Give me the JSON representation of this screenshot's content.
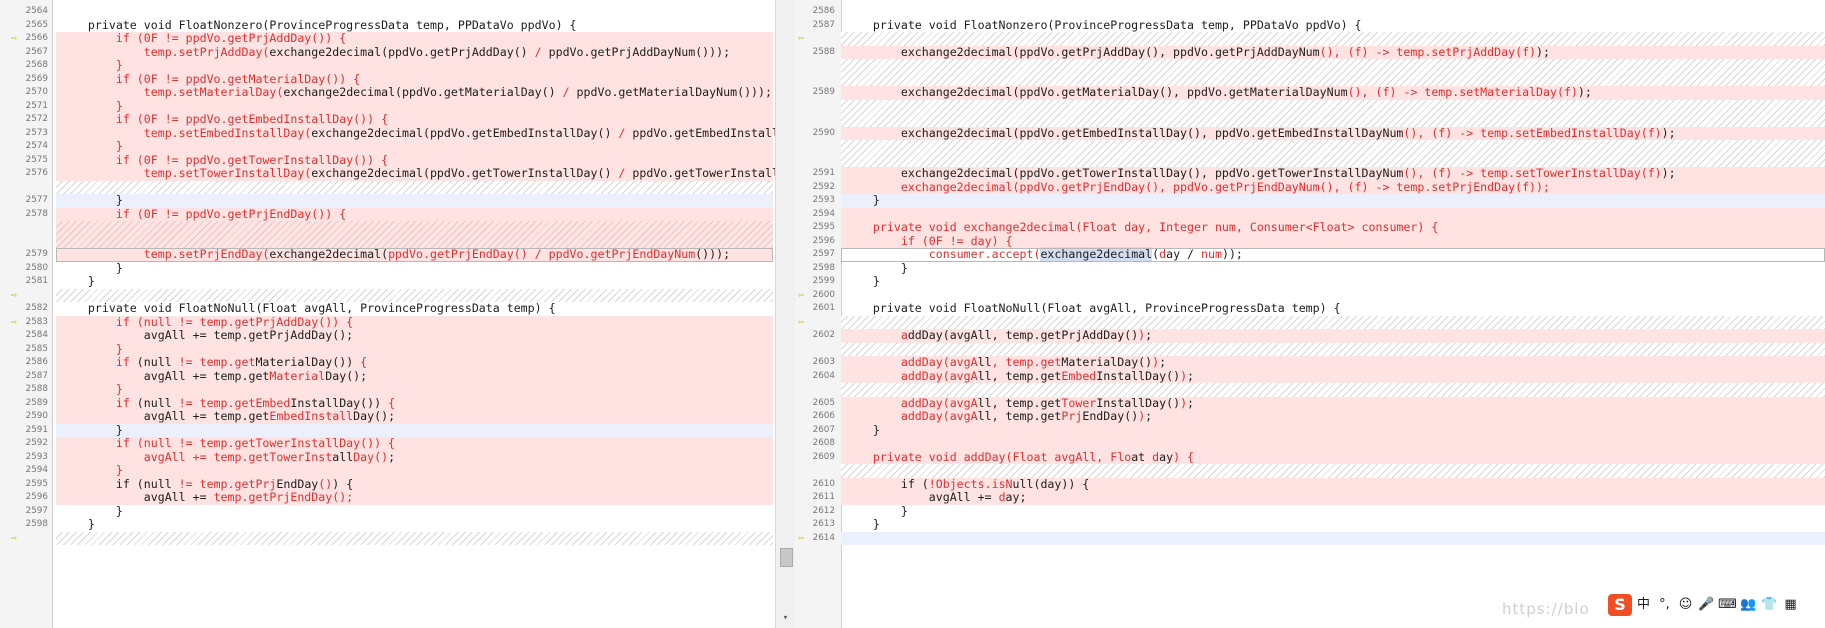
{
  "left": {
    "rows": [
      {
        "ln": "2564",
        "cls": "",
        "html": ""
      },
      {
        "ln": "2565",
        "cls": "",
        "html": "    private void FloatNonzero(ProvinceProgressData temp, PPDataVo ppdVo) {"
      },
      {
        "ln": "2566",
        "cls": "row-change",
        "arrow": true,
        "html": "<span class=r>        if (0F != ppdVo.getPrjAddDay()) {</span>"
      },
      {
        "ln": "2567",
        "cls": "row-change",
        "html": "            <span class=r>temp.setPrjAddDay(</span>exchange2decimal(ppdVo.getPrjAddDay() <span class=r>/</span> ppdVo.getPrjAddDayNum()));"
      },
      {
        "ln": "2568",
        "cls": "row-change",
        "html": "<span class=r>        }</span>"
      },
      {
        "ln": "2569",
        "cls": "row-change",
        "html": "<span class=r>        if (0F != ppdVo.getMaterialDay()) {</span>"
      },
      {
        "ln": "2570",
        "cls": "row-change",
        "html": "            <span class=r>temp.setMaterialDay(</span>exchange2decimal(ppdVo.getMaterialDay() <span class=r>/</span> ppdVo.getMaterialDayNum()));"
      },
      {
        "ln": "2571",
        "cls": "row-change",
        "html": "<span class=r>        }</span>"
      },
      {
        "ln": "2572",
        "cls": "row-change",
        "html": "<span class=r>        if (0F != ppdVo.getEmbedInstallDay()) {</span>"
      },
      {
        "ln": "2573",
        "cls": "row-change",
        "html": "            <span class=r>temp.setEmbedInstallDay(</span>exchange2decimal(ppdVo.getEmbedInstallDay() <span class=r>/</span> ppdVo.getEmbedInstallD"
      },
      {
        "ln": "2574",
        "cls": "row-change",
        "html": "<span class=r>        }</span>"
      },
      {
        "ln": "2575",
        "cls": "row-change",
        "html": "<span class=r>        if (0F != ppdVo.getTowerInstallDay()) {</span>"
      },
      {
        "ln": "2576",
        "cls": "row-change",
        "html": "            <span class=r>temp.setTowerInstallDay(</span>exchange2decimal(ppdVo.getTowerInstallDay() <span class=r>/</span> ppdVo.getTowerInstallD"
      },
      {
        "hatch": 1
      },
      {
        "ln": "2577",
        "cls": "row-blank",
        "html": "        }"
      },
      {
        "ln": "2578",
        "cls": "row-change",
        "html": "<span class=r>        if (0F != ppdVo.getPrjEndDay()) {</span>"
      },
      {
        "hatch": 2,
        "pink": true
      },
      {
        "ln": "2579",
        "cls": "row-change row-boxed",
        "html": "            <span class=r>temp.setPrjEndDay(</span>exchange2decimal(<span class=r>ppdVo.getPrjEndDay() / ppdVo.getPrjEndDayNum</span>()));"
      },
      {
        "ln": "2580",
        "cls": "",
        "html": "        }"
      },
      {
        "ln": "2581",
        "cls": "",
        "html": "    }"
      },
      {
        "hatch": 1,
        "arrow": true
      },
      {
        "ln": "2582",
        "cls": "",
        "html": "    private void FloatNoNull(Float avgAll, ProvinceProgressData temp) {"
      },
      {
        "ln": "2583",
        "cls": "row-change",
        "arrow": true,
        "html": "<span class=r>        if (null != temp.getPrjAddDay()) {</span>"
      },
      {
        "ln": "2584",
        "cls": "row-change",
        "html": "            avgAll += temp.getPrjAddDay();"
      },
      {
        "ln": "2585",
        "cls": "row-change",
        "html": "<span class=r>        }</span>"
      },
      {
        "ln": "2586",
        "cls": "row-change",
        "html": "<span class=r>        if </span>(null <span class=r>!= temp.get</span>MaterialDay()) <span class=r>{</span>"
      },
      {
        "ln": "2587",
        "cls": "row-change",
        "html": "            avgAll += temp.get<span class=r>Material</span>Day();"
      },
      {
        "ln": "2588",
        "cls": "row-change",
        "html": "<span class=r>        }</span>"
      },
      {
        "ln": "2589",
        "cls": "row-change",
        "html": "<span class=r>        if </span>(null <span class=r>!= temp.get</span><span class=r>Embed</span>InstallDay()) <span class=r>{</span>"
      },
      {
        "ln": "2590",
        "cls": "row-change",
        "html": "            avgAll += temp.get<span class=r>EmbedInstall</span>Day();"
      },
      {
        "ln": "2591",
        "cls": "row-blank",
        "html": "        }"
      },
      {
        "ln": "2592",
        "cls": "row-change",
        "html": "<span class=r>        if (null != temp.getTowerInstallDay()) {</span>"
      },
      {
        "ln": "2593",
        "cls": "row-change",
        "html": "            <span class=r>avgAll += temp.getTowerInst</span>all<span class=r>Day()</span>;"
      },
      {
        "ln": "2594",
        "cls": "row-change",
        "html": "<span class=r>        }</span>"
      },
      {
        "ln": "2595",
        "cls": "row-change",
        "html": "        if (null <span class=r>!= temp.getPrj</span>EndDay<span class=r>()</span>) {"
      },
      {
        "ln": "2596",
        "cls": "row-change",
        "html": "            avgAll += <span class=r>temp.getPrjEndDay();</span>"
      },
      {
        "ln": "2597",
        "cls": "",
        "html": "        }"
      },
      {
        "ln": "2598",
        "cls": "",
        "html": "    }"
      },
      {
        "hatch": 1,
        "arrow": true
      }
    ]
  },
  "right": {
    "rows": [
      {
        "ln": "2586",
        "cls": "",
        "html": ""
      },
      {
        "ln": "2587",
        "cls": "",
        "html": "    private void FloatNonzero(ProvinceProgressData temp, PPDataVo ppdVo) {"
      },
      {
        "hatch": 1,
        "arrow": true
      },
      {
        "ln": "2588",
        "cls": "row-change",
        "html": "        exchange2decimal(ppdVo.getPrjAddDay(), ppdVo.getPrjAddDayNum<span class=r>(), (f) -&gt; temp.setPrjAddDay(f)</span>);"
      },
      {
        "hatch": 2
      },
      {
        "ln": "2589",
        "cls": "row-change",
        "html": "        exchange2decimal(ppdVo.getMaterialDay(), ppdVo.getMaterialDayNum<span class=r>(), (f) -&gt; temp.setMaterialDay(f)</span>);"
      },
      {
        "hatch": 2
      },
      {
        "ln": "2590",
        "cls": "row-change",
        "html": "        exchange2decimal(ppdVo.getEmbedInstallDay(), ppdVo.getEmbedInstallDayNum<span class=r>(), (f) -&gt; temp.setEmbedInstallDay(f)</span>);"
      },
      {
        "hatch": 2
      },
      {
        "ln": "2591",
        "cls": "row-change",
        "html": "        exchange2decimal(ppdVo.getTowerInstallDay(), ppdVo.getTowerInstallDayNum<span class=r>(), (f) -&gt; temp.setTowerInstallDay(f)</span>);"
      },
      {
        "ln": "2592",
        "cls": "row-change",
        "html": "<span class=r>        exchange2decimal(ppdVo.getPrjEndDay(), ppdVo.getPrjEndDayNum(), (f) -&gt; temp.setPrjEndDay(f));</span>"
      },
      {
        "ln": "2593",
        "cls": "row-blank",
        "html": "    }"
      },
      {
        "ln": "2594",
        "cls": "row-change",
        "html": ""
      },
      {
        "ln": "2595",
        "cls": "row-change",
        "html": "<span class=r>    private void exchange2decimal(Float day, Integer num, Consumer&lt;Float&gt; consumer) {</span>"
      },
      {
        "ln": "2596",
        "cls": "row-change",
        "html": "<span class=r>        if (0F != day) {</span>"
      },
      {
        "ln": "2597",
        "cls": "row-boxed",
        "html": "            <span class=r>consumer.accept(</span><span class=hl>exchange2decimal</span>(<span class=r>d</span>ay / <span class=r>num</span>));"
      },
      {
        "ln": "2598",
        "cls": "",
        "html": "        }"
      },
      {
        "ln": "2599",
        "cls": "",
        "html": "    }"
      },
      {
        "ln": "2600",
        "cls": "",
        "arrow": true,
        "html": ""
      },
      {
        "ln": "2601",
        "cls": "",
        "html": "    private void FloatNoNull(Float avgAll, ProvinceProgressData temp) {"
      },
      {
        "hatch": 1,
        "arrow": true
      },
      {
        "ln": "2602",
        "cls": "row-change",
        "html": "        <span class=r>a</span>ddDay(avgAll, temp.getPrjAddDay()<span class=r>)</span>;"
      },
      {
        "hatch": 1
      },
      {
        "ln": "2603",
        "cls": "row-change",
        "html": "        <span class=r>addDay(avgA</span>ll<span class=r>, temp.get</span>MaterialDay()<span class=r>)</span>;"
      },
      {
        "ln": "2604",
        "cls": "row-change",
        "html": "        <span class=r>addDay(avgA</span>ll, temp.get<span class=r>Embed</span>InstallDay()<span class=r>)</span>;"
      },
      {
        "hatch": 1
      },
      {
        "ln": "2605",
        "cls": "row-change",
        "html": "        <span class=r>addDay(avgA</span>ll, temp.get<span class=r>Tower</span>InstallDay()<span class=r>)</span>;"
      },
      {
        "ln": "2606",
        "cls": "row-change",
        "html": "        <span class=r>addDay(avgA</span>ll, temp.get<span class=r>Prj</span>EndDay()<span class=r>)</span>;"
      },
      {
        "ln": "2607",
        "cls": "row-change",
        "html": "    }"
      },
      {
        "ln": "2608",
        "cls": "row-change",
        "html": ""
      },
      {
        "ln": "2609",
        "cls": "row-change",
        "html": "<span class=r>    private void addDay(Float avgAll, Flo</span>at <span class=r>d</span>ay<span class=r>) {</span>"
      },
      {
        "hatch": 1
      },
      {
        "ln": "2610",
        "cls": "row-change",
        "html": "        if (<span class=r>!Objects.isN</span>ull(day)) {"
      },
      {
        "ln": "2611",
        "cls": "row-change",
        "html": "            avgAll += <span class=r>d</span>ay;"
      },
      {
        "ln": "2612",
        "cls": "",
        "html": "        }"
      },
      {
        "ln": "2613",
        "cls": "",
        "html": "    }"
      },
      {
        "ln": "2614",
        "cls": "row-blank",
        "arrow": true,
        "html": ""
      }
    ]
  },
  "ime": {
    "logo": "S",
    "items": [
      "中",
      "°,",
      "☺",
      "🎤",
      "⌨",
      "👥",
      "👕",
      "▦"
    ]
  },
  "watermark": "https://blo"
}
